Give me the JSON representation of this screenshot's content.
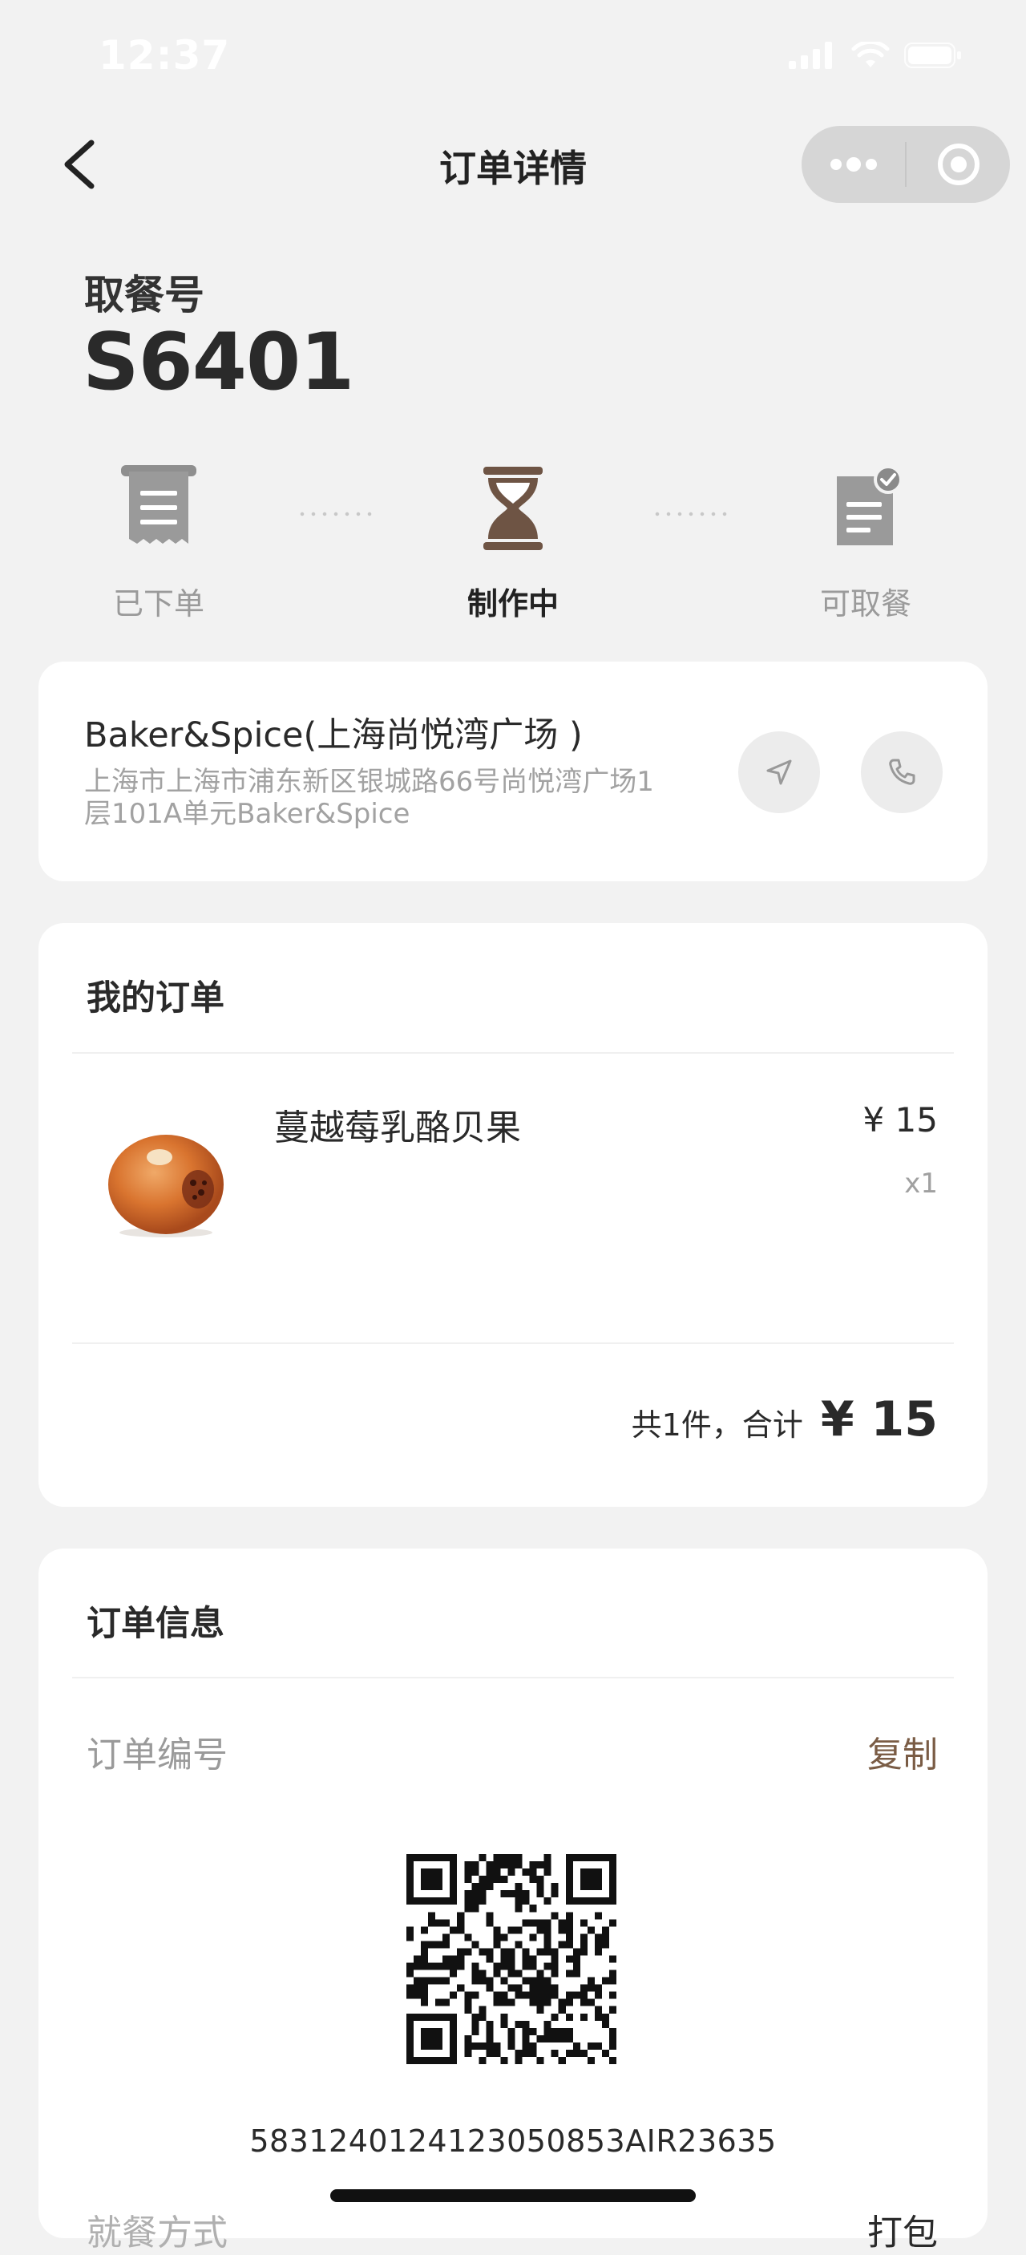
{
  "status_bar": {
    "time": "12:37"
  },
  "nav": {
    "title": "订单详情"
  },
  "pickup": {
    "label": "取餐号",
    "number": "S6401"
  },
  "steps": [
    {
      "label": "已下单",
      "icon": "receipt-icon"
    },
    {
      "label": "制作中",
      "icon": "hourglass-icon"
    },
    {
      "label": "可取餐",
      "icon": "document-check-icon"
    }
  ],
  "store": {
    "name": "Baker&Spice(上海尚悦湾广场 )",
    "address_line1": "上海市上海市浦东新区银城路66号尚悦湾广场1",
    "address_line2": "层101A单元Baker&Spice"
  },
  "my_order": {
    "title": "我的订单",
    "items": [
      {
        "name": "蔓越莓乳酪贝果",
        "price": "¥ 15",
        "qty": "x1",
        "image": "bagel"
      }
    ],
    "total_text": "共1件，合计",
    "total_amount": "¥ 15"
  },
  "order_info": {
    "title": "订单信息",
    "order_number_label": "订单编号",
    "copy_label": "复制",
    "order_number": "583124012412305085​3AIR23635",
    "next_row_label": "就餐方式",
    "next_row_value": "打包"
  },
  "colors": {
    "accent": "#7a5c45",
    "active_step": "#6e5444"
  }
}
